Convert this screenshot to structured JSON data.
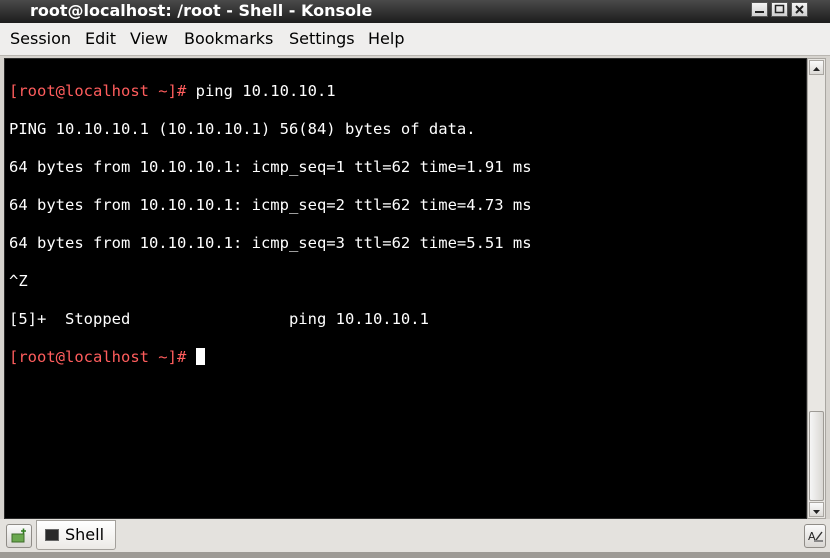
{
  "window": {
    "title": "root@localhost: /root - Shell - Konsole"
  },
  "menu": {
    "items": [
      "Session",
      "Edit",
      "View",
      "Bookmarks",
      "Settings",
      "Help"
    ]
  },
  "terminal": {
    "lines": [
      {
        "prompt": "[root@localhost ~]#",
        "text": " ping 10.10.10.1"
      },
      {
        "prompt": "",
        "text": "PING 10.10.10.1 (10.10.10.1) 56(84) bytes of data."
      },
      {
        "prompt": "",
        "text": "64 bytes from 10.10.10.1: icmp_seq=1 ttl=62 time=1.91 ms"
      },
      {
        "prompt": "",
        "text": "64 bytes from 10.10.10.1: icmp_seq=2 ttl=62 time=4.73 ms"
      },
      {
        "prompt": "",
        "text": "64 bytes from 10.10.10.1: icmp_seq=3 ttl=62 time=5.51 ms"
      },
      {
        "prompt": "",
        "text": "^Z"
      },
      {
        "prompt": "",
        "text": "[5]+  Stopped                 ping 10.10.10.1"
      },
      {
        "prompt": "[root@localhost ~]#",
        "text": " "
      }
    ],
    "colors": {
      "prompt": "#ff5d5d",
      "text": "#ffffff",
      "background": "#000000"
    }
  },
  "tabs": {
    "items": [
      {
        "label": "Shell",
        "icon": "terminal-icon"
      }
    ]
  },
  "icons": {
    "minimize": "minimize-icon",
    "maximize": "maximize-icon",
    "close": "close-icon",
    "new_tab": "new-tab-icon",
    "rename": "rename-tab-icon"
  }
}
